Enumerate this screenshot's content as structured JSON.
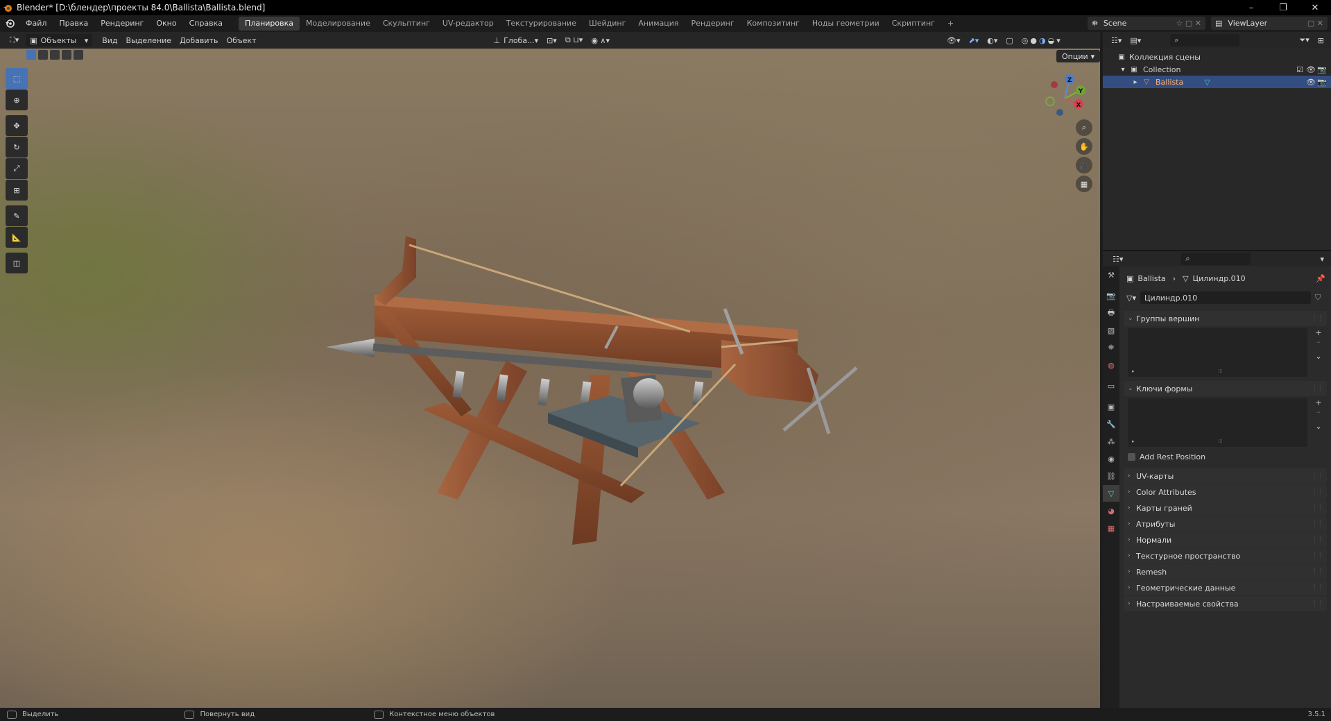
{
  "window": {
    "title": "Blender* [D:\\блендер\\проекты 84.0\\Ballista\\Ballista.blend]",
    "controls": [
      "–",
      "❐",
      "✕"
    ]
  },
  "menu": [
    "Файл",
    "Правка",
    "Рендеринг",
    "Окно",
    "Справка"
  ],
  "workspaces": [
    {
      "label": "Планировка",
      "active": true
    },
    {
      "label": "Моделирование"
    },
    {
      "label": "Скульптинг"
    },
    {
      "label": "UV-редактор"
    },
    {
      "label": "Текстурирование"
    },
    {
      "label": "Шейдинг"
    },
    {
      "label": "Анимация"
    },
    {
      "label": "Рендеринг"
    },
    {
      "label": "Композитинг"
    },
    {
      "label": "Ноды геометрии"
    },
    {
      "label": "Скриптинг"
    }
  ],
  "add_workspace": "+",
  "scene": {
    "label": "Scene"
  },
  "view_layer": {
    "label": "ViewLayer"
  },
  "viewport_header": {
    "mode": "Объекты",
    "menus": [
      "Вид",
      "Выделение",
      "Добавить",
      "Объект"
    ],
    "orientation": "Глоба...",
    "options": "Опции"
  },
  "gizmo": {
    "z": "Z",
    "y": "Y",
    "x": "X"
  },
  "outliner": {
    "scene_collection": "Коллекция сцены",
    "collection": "Collection",
    "object": "Ballista"
  },
  "properties": {
    "breadcrumb_object": "Ballista",
    "breadcrumb_mesh": "Цилиндр.010",
    "mesh_name": "Цилиндр.010",
    "panels": {
      "vertex_groups": "Группы вершин",
      "shape_keys": "Ключи формы",
      "add_rest_position": "Add Rest Position",
      "collapsed": [
        "UV-карты",
        "Color Attributes",
        "Карты граней",
        "Атрибуты",
        "Нормали",
        "Текстурное пространство",
        "Remesh",
        "Геометрические данные",
        "Настраиваемые свойства"
      ]
    }
  },
  "statusbar": {
    "select": "Выделить",
    "rotate": "Повернуть вид",
    "context": "Контекстное меню объектов",
    "version": "3.5.1"
  },
  "colors": {
    "accent": "#4772b3",
    "selection": "#334d80",
    "wood": "#8a4f30",
    "metal": "#8e8e8e"
  }
}
